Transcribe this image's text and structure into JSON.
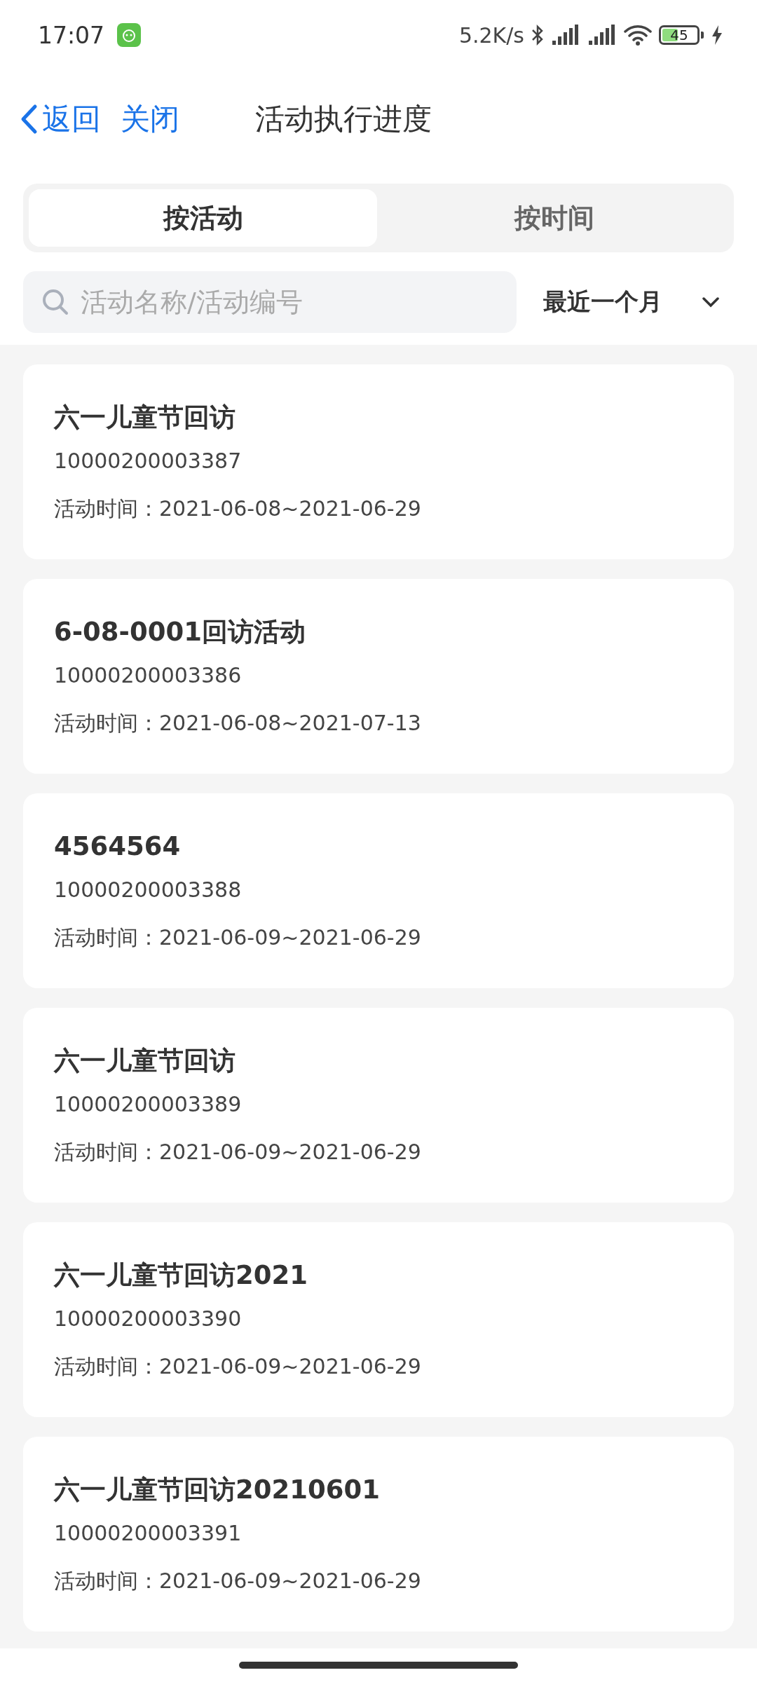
{
  "status_bar": {
    "time": "17:07",
    "net_speed": "5.2K/s",
    "battery": "45"
  },
  "header": {
    "back": "返回",
    "close": "关闭",
    "title": "活动执行进度"
  },
  "tabs": [
    {
      "label": "按活动",
      "selected": true
    },
    {
      "label": "按时间",
      "selected": false
    }
  ],
  "search": {
    "placeholder": "活动名称/活动编号"
  },
  "filter": {
    "value": "最近一个月"
  },
  "activities": [
    {
      "name": "六一儿童节回访",
      "code": "10000200003387",
      "time": "活动时间：2021-06-08~2021-06-29"
    },
    {
      "name": "6-08-0001回访活动",
      "code": "10000200003386",
      "time": "活动时间：2021-06-08~2021-07-13"
    },
    {
      "name": "4564564",
      "code": "10000200003388",
      "time": "活动时间：2021-06-09~2021-06-29"
    },
    {
      "name": "六一儿童节回访",
      "code": "10000200003389",
      "time": "活动时间：2021-06-09~2021-06-29"
    },
    {
      "name": "六一儿童节回访2021",
      "code": "10000200003390",
      "time": "活动时间：2021-06-09~2021-06-29"
    },
    {
      "name": "六一儿童节回访20210601",
      "code": "10000200003391",
      "time": "活动时间：2021-06-09~2021-06-29"
    }
  ]
}
